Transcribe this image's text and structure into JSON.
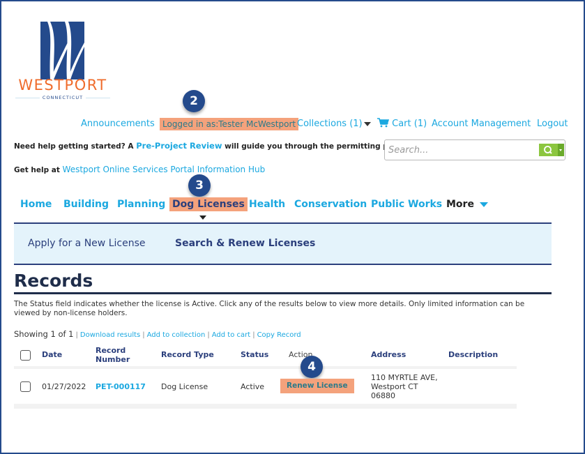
{
  "logo": {
    "wordmark": "WESTPORT",
    "subtitle": "CONNECTICUT",
    "brand_blue": "#244a8c",
    "brand_orange": "#ef6c2c"
  },
  "header": {
    "links": {
      "announcements": "Announcements",
      "logged_in": "Logged in as:Tester McWestport",
      "collections": "Collections (1)",
      "cart": "Cart (1)",
      "account_management": "Account Management",
      "logout": "Logout"
    },
    "help_line1": {
      "prefix": "Need help getting started?  A ",
      "link": "Pre-Project Review",
      "suffix": " will guide you through the permitting process."
    },
    "help_line2": {
      "prefix": "Get help at ",
      "link": "Westport Online Services Portal Information Hub"
    },
    "search": {
      "placeholder": "Search...",
      "value": ""
    }
  },
  "badges": {
    "step2": "2",
    "step3": "3",
    "step4": "4"
  },
  "main_nav": {
    "items": [
      "Home",
      "Building",
      "Planning",
      "Dog Licenses",
      "Health",
      "Conservation",
      "Public Works",
      "More"
    ],
    "active": "Dog Licenses"
  },
  "sub_nav": {
    "items": [
      "Apply for a New License",
      "Search & Renew Licenses"
    ],
    "active": "Search & Renew Licenses"
  },
  "records": {
    "title": "Records",
    "description": "The Status field indicates whether the license is Active. Click any of the results below to view more details. Only limited information can be viewed by non-license holders.",
    "showing": "Showing 1 of 1",
    "actions": [
      "Download results",
      "Add to collection",
      "Add to cart",
      "Copy Record"
    ],
    "columns": [
      "Date",
      "Record Number",
      "Record Type",
      "Status",
      "Action",
      "Address",
      "Description"
    ],
    "rows": [
      {
        "date": "01/27/2022",
        "record_number": "PET-000117",
        "record_type": "Dog License",
        "status": "Active",
        "action": "Renew License",
        "address_line1": "110 MYRTLE AVE,",
        "address_line2": "Westport CT",
        "address_line3": "06880",
        "description": ""
      }
    ]
  },
  "colors": {
    "link": "#1ba8e0",
    "highlight": "#f4a27c",
    "nav_text": "#2b3f7c",
    "subnav_bg": "#e4f3fb",
    "search_green": "#8cc63f"
  }
}
